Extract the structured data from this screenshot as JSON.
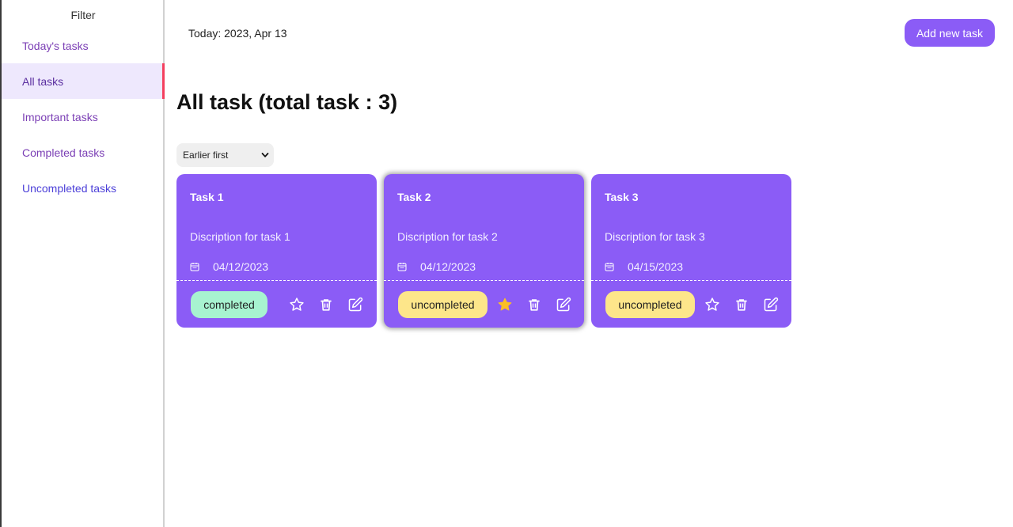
{
  "sidebar": {
    "title": "Filter",
    "items": [
      {
        "label": "Today's tasks"
      },
      {
        "label": "All tasks"
      },
      {
        "label": "Important tasks"
      },
      {
        "label": "Completed tasks"
      },
      {
        "label": "Uncompleted tasks"
      }
    ],
    "active_index": 1
  },
  "header": {
    "today": "Today: 2023, Apr 13",
    "add_button": "Add new task"
  },
  "main": {
    "title": "All task (total task : 3)",
    "sort": {
      "selected": "Earlier first"
    },
    "tasks": [
      {
        "title": "Task 1",
        "description": "Discription for task 1",
        "date": "04/12/2023",
        "status": "completed",
        "important": false
      },
      {
        "title": "Task 2",
        "description": "Discription for task 2",
        "date": "04/12/2023",
        "status": "uncompleted",
        "important": true
      },
      {
        "title": "Task 3",
        "description": "Discription for task 3",
        "date": "04/15/2023",
        "status": "uncompleted",
        "important": false
      }
    ]
  },
  "colors": {
    "accent": "#8b5cf6",
    "completed": "#a7f3d0",
    "uncompleted": "#fde68a",
    "star_active": "#fbbf24",
    "active_marker": "#f43f5e"
  },
  "icons": {
    "calendar": "calendar-icon",
    "star": "star-icon",
    "delete": "trash-icon",
    "edit": "edit-icon",
    "dropdown": "chevron-down-icon"
  }
}
